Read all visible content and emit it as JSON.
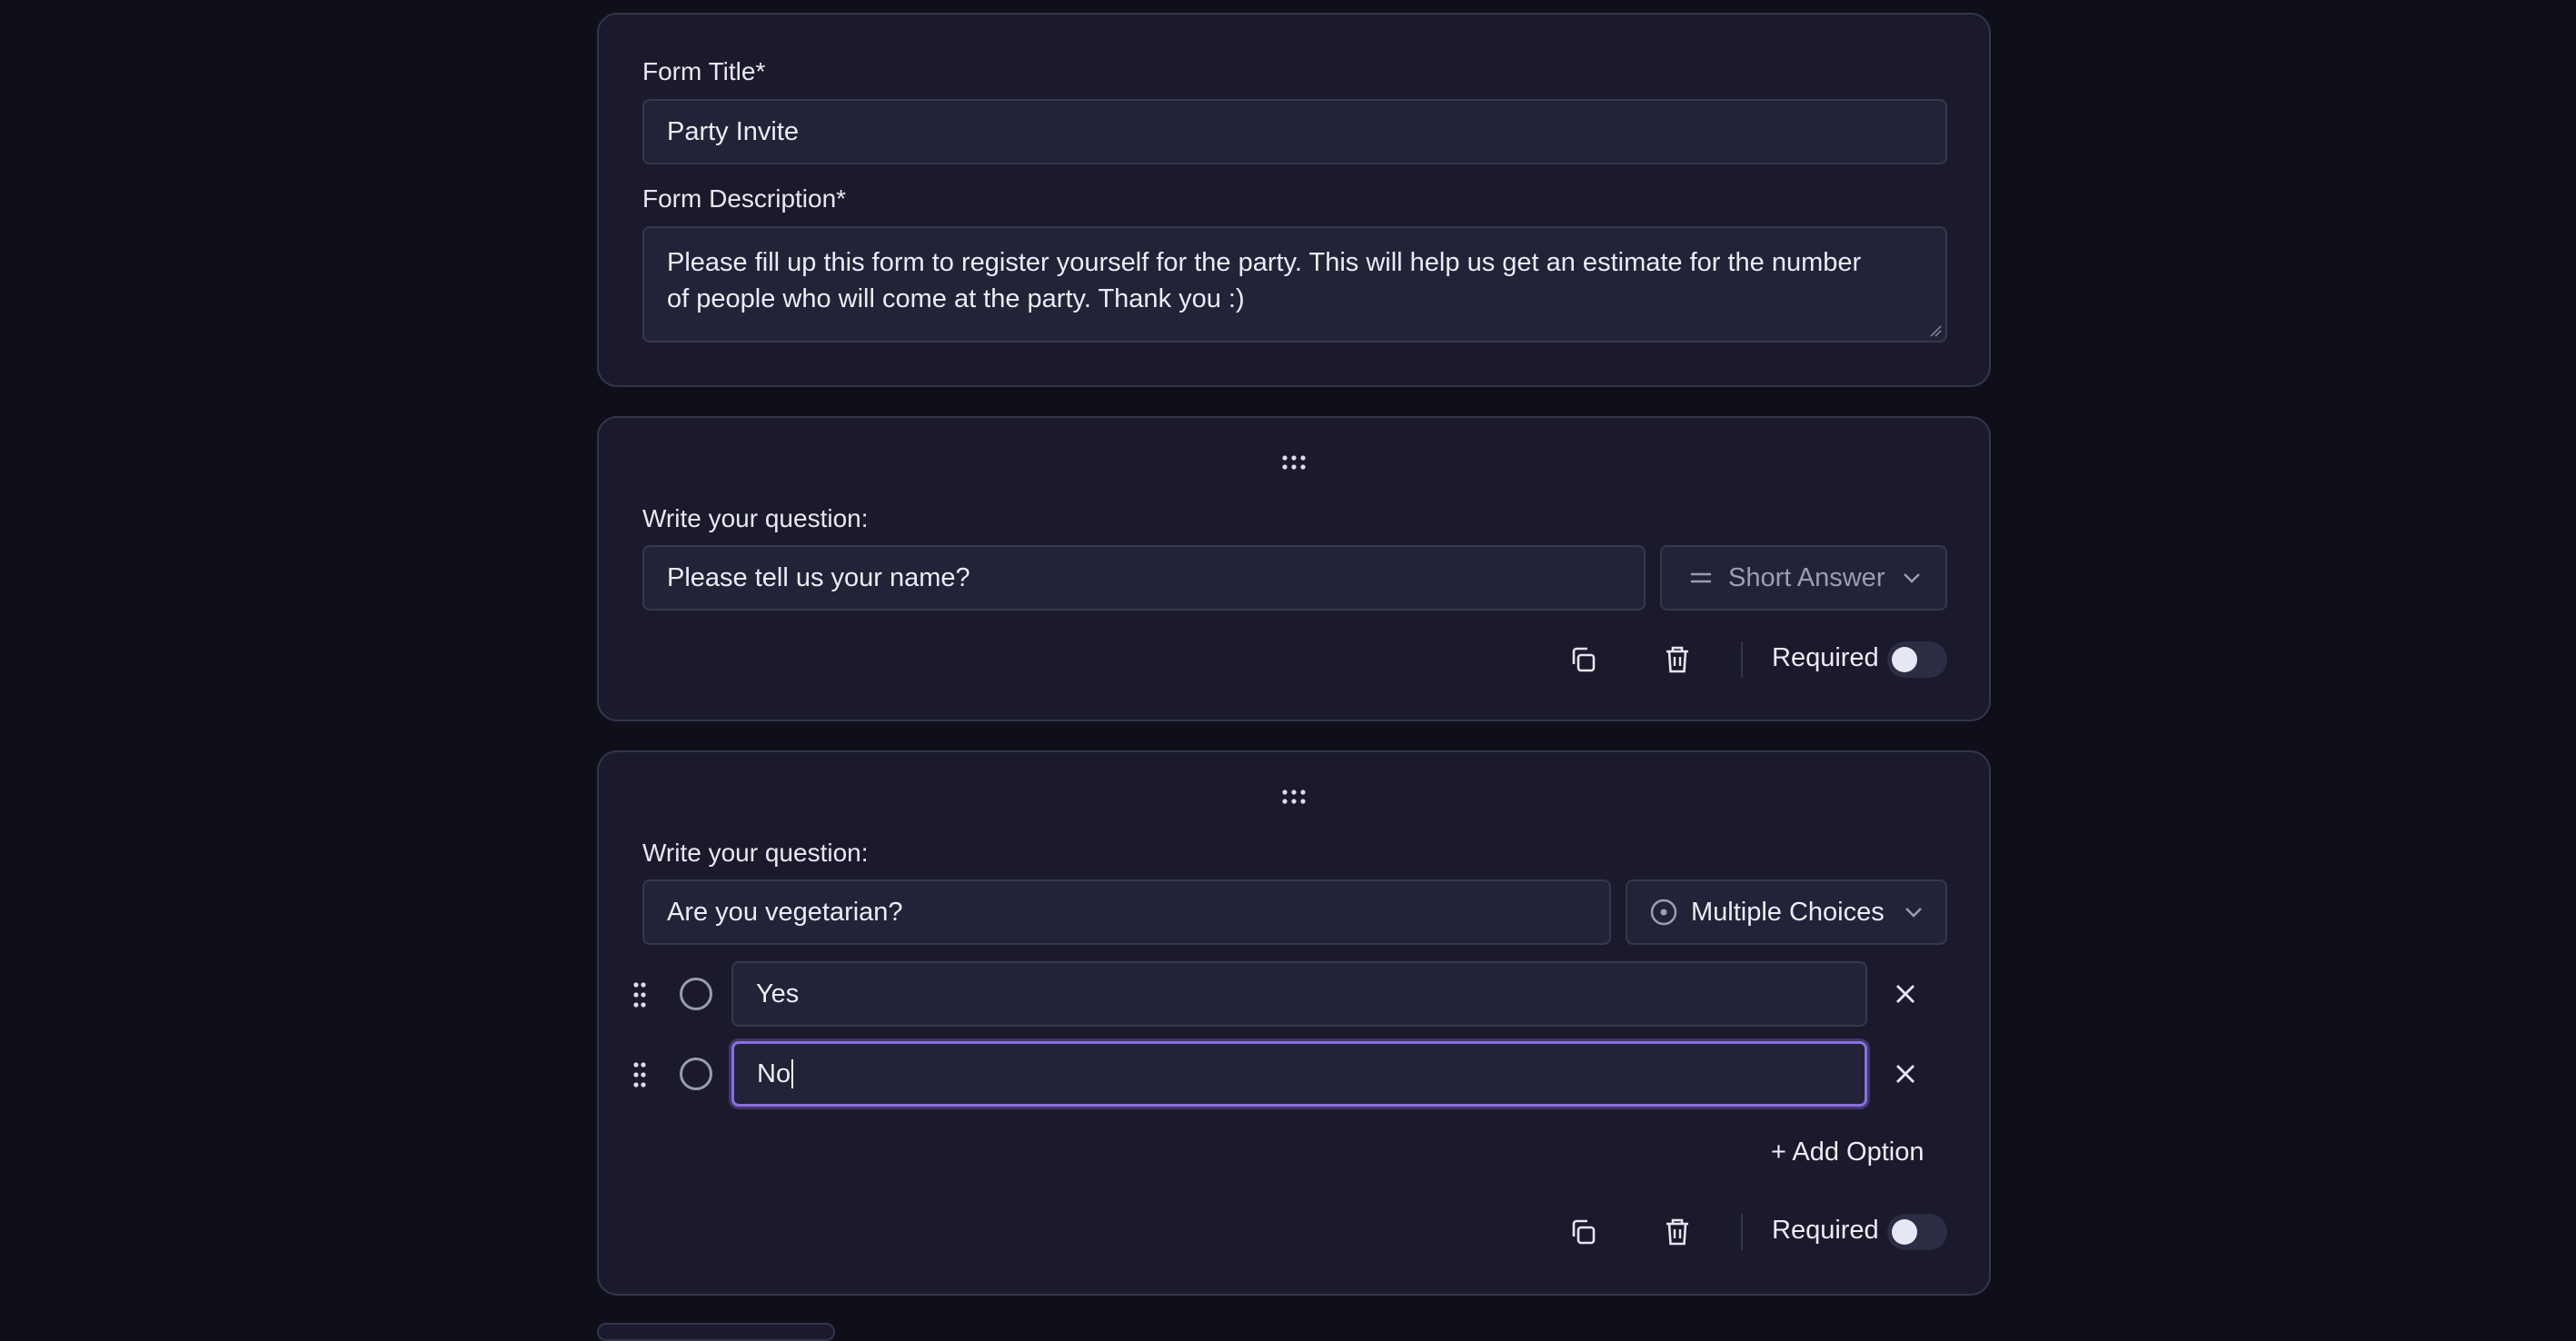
{
  "form_header": {
    "title_label": "Form Title*",
    "title_value": "Party Invite",
    "description_label": "Form Description*",
    "description_value": "Please fill up this form to register yourself for the party. This will help us get an estimate for the number of people who will come at the party. Thank you :)"
  },
  "questions": [
    {
      "label": "Write your question:",
      "value": "Please tell us your name?",
      "type": "Short Answer",
      "type_icon": "short-answer-icon",
      "required_label": "Required",
      "required": false
    },
    {
      "label": "Write your question:",
      "value": "Are you vegetarian?",
      "type": "Multiple Choices",
      "type_icon": "radio-icon",
      "options": [
        "Yes",
        "No"
      ],
      "add_option_label": "+ Add Option",
      "required_label": "Required",
      "required": false
    }
  ],
  "colors": {
    "background": "#0f0f1a",
    "card": "#1a1a2c",
    "focus_ring": "#8a6fe0"
  }
}
